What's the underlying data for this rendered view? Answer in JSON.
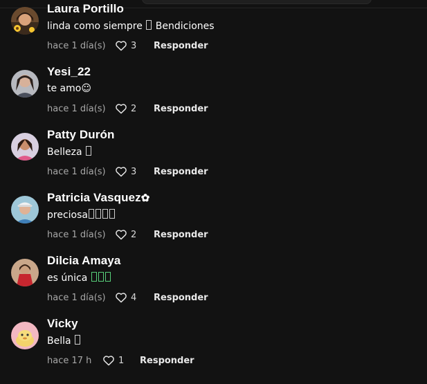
{
  "colors": {
    "background": "#121212",
    "text": "#ffffff",
    "muted": "#a8a8a8"
  },
  "comments": [
    {
      "username": "Laura Portillo",
      "text": "linda como siempre  Bendiciones",
      "time": "hace 1 día(s)",
      "likes": "3",
      "reply_label": "Responder",
      "avatar_icon": "avatar-photo"
    },
    {
      "username": "Yesi_22",
      "text": "te amo☺",
      "time": "hace 1 día(s)",
      "likes": "2",
      "reply_label": "Responder",
      "avatar_icon": "avatar-photo"
    },
    {
      "username": "Patty Durón",
      "text": "Belleza ",
      "time": "hace 1 día(s)",
      "likes": "3",
      "reply_label": "Responder",
      "avatar_icon": "avatar-photo"
    },
    {
      "username": "Patricia Vasquez",
      "username_suffix": "✿",
      "text": "preciosa",
      "time": "hace 1 día(s)",
      "likes": "2",
      "reply_label": "Responder",
      "avatar_icon": "avatar-photo"
    },
    {
      "username": "Dilcia Amaya",
      "text": "es única ",
      "time": "hace 1 día(s)",
      "likes": "4",
      "reply_label": "Responder",
      "avatar_icon": "avatar-photo"
    },
    {
      "username": "Vicky",
      "text": "Bella ",
      "time": "hace 17 h",
      "likes": "1",
      "reply_label": "Responder",
      "avatar_icon": "avatar-cartoon"
    }
  ]
}
